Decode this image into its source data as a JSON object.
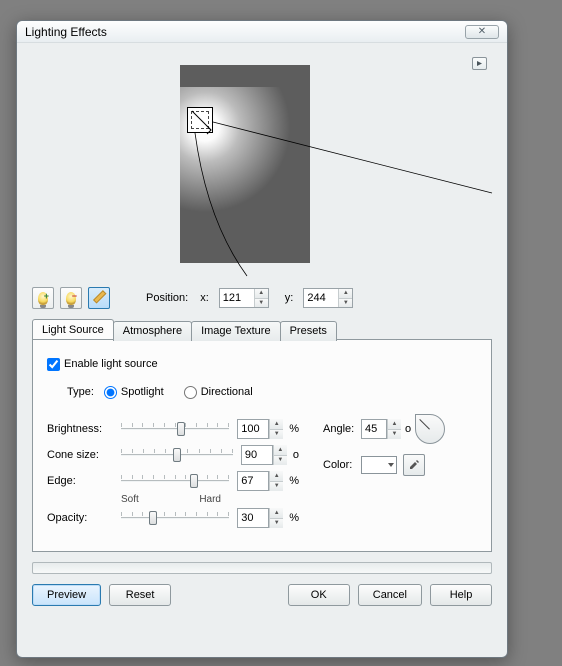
{
  "dialog": {
    "title": "Lighting Effects"
  },
  "position": {
    "label": "Position:",
    "x_label": "x:",
    "x": "121",
    "y_label": "y:",
    "y": "244"
  },
  "tabs": {
    "light": "Light Source",
    "atmo": "Atmosphere",
    "tex": "Image Texture",
    "presets": "Presets"
  },
  "ls": {
    "enable": "Enable light source",
    "type_label": "Type:",
    "spot": "Spotlight",
    "dir": "Directional",
    "brightness_label": "Brightness:",
    "brightness": "100",
    "brightness_unit": "%",
    "cone_label": "Cone size:",
    "cone": "90",
    "cone_unit": "o",
    "edge_label": "Edge:",
    "edge": "67",
    "edge_unit": "%",
    "soft": "Soft",
    "hard": "Hard",
    "opacity_label": "Opacity:",
    "opacity": "30",
    "opacity_unit": "%",
    "angle_label": "Angle:",
    "angle": "45",
    "angle_unit": "o",
    "color_label": "Color:",
    "color": "#ffffff"
  },
  "buttons": {
    "preview": "Preview",
    "reset": "Reset",
    "ok": "OK",
    "cancel": "Cancel",
    "help": "Help"
  },
  "chart_data": {
    "type": "table",
    "title": "Light Source parameters",
    "series": [
      {
        "name": "Brightness",
        "value": 100,
        "unit": "%",
        "range": [
          0,
          100
        ]
      },
      {
        "name": "Cone size",
        "value": 90,
        "unit": "deg",
        "range": [
          0,
          359
        ]
      },
      {
        "name": "Edge",
        "value": 67,
        "unit": "%",
        "range": [
          0,
          100
        ]
      },
      {
        "name": "Opacity",
        "value": 30,
        "unit": "%",
        "range": [
          0,
          100
        ]
      },
      {
        "name": "Angle",
        "value": 45,
        "unit": "deg",
        "range": [
          0,
          359
        ]
      },
      {
        "name": "Position x",
        "value": 121,
        "unit": "px"
      },
      {
        "name": "Position y",
        "value": 244,
        "unit": "px"
      }
    ]
  }
}
